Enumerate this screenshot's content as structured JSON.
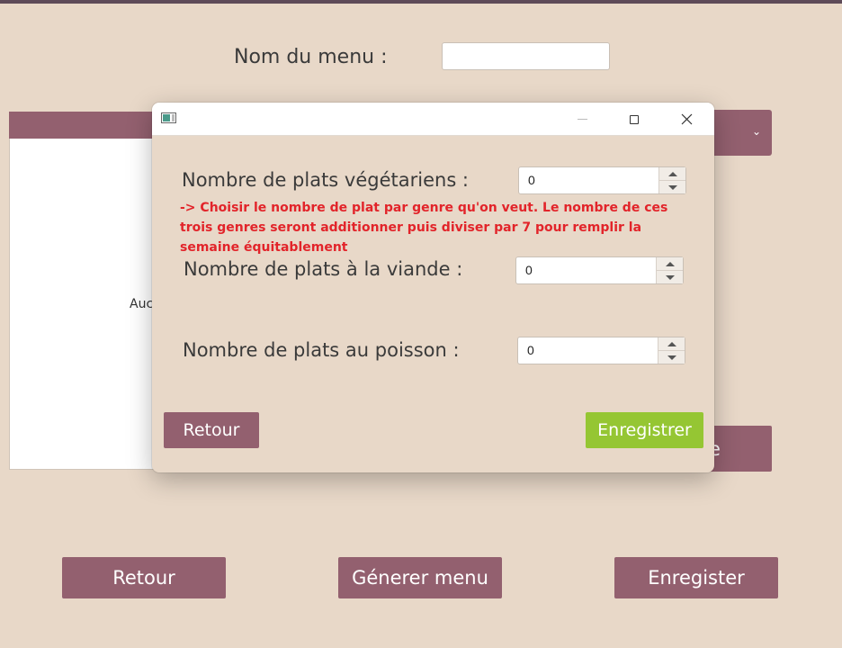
{
  "main": {
    "menu_name_label": "Nom du menu :",
    "menu_name_value": "",
    "list_placeholder_partial": "Auc",
    "hidden_button_partial": "e",
    "buttons": {
      "back": "Retour",
      "generate": "Génerer menu",
      "save": "Enregister"
    }
  },
  "dialog": {
    "fields": {
      "vegetarian_label": "Nombre de plats végétariens :",
      "vegetarian_value": "0",
      "meat_label": "Nombre de plats à la viande :",
      "meat_value": "0",
      "fish_label": "Nombre de plats au poisson :",
      "fish_value": "0"
    },
    "hint": "-> Choisir le nombre de plat par genre qu'on veut. Le nombre de ces trois genres seront additionner puis diviser par 7 pour remplir la semaine équitablement",
    "buttons": {
      "back": "Retour",
      "save": "Enregistrer"
    }
  },
  "colors": {
    "background": "#e8d8c8",
    "button": "#93606f",
    "save_green": "#95c633",
    "hint_red": "#e2242a"
  },
  "icons": {
    "spinner_up": "triangle-up",
    "spinner_down": "triangle-down",
    "close": "x",
    "maximize": "square",
    "minimize": "line",
    "dropdown": "chevron-down"
  }
}
